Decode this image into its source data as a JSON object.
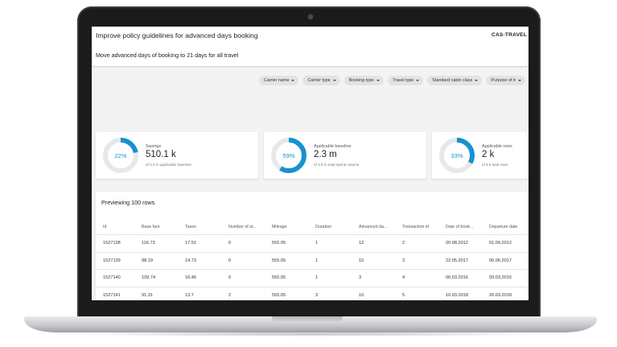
{
  "header": {
    "title": "Improve policy guidelines for advanced days booking",
    "brand": "CAS-TRAVEL",
    "subtitle": "Move advanced days of booking to 21 days for all travel"
  },
  "filters": [
    {
      "label": "Carrier name",
      "icon": "caret-down-icon"
    },
    {
      "label": "Carrier type",
      "icon": "caret-down-icon"
    },
    {
      "label": "Booking type",
      "icon": "caret-down-icon"
    },
    {
      "label": "Travel type",
      "icon": "caret-down-icon"
    },
    {
      "label": "Standard cabin class",
      "icon": "caret-down-icon"
    },
    {
      "label": "Purpose of tr",
      "icon": "caret-down-icon"
    }
  ],
  "kpis": [
    {
      "percent_label": "22%",
      "percent": 22,
      "label": "Savings",
      "value": "510.1 k",
      "sub": "of 2.3 m applicable baseline"
    },
    {
      "percent_label": "59%",
      "percent": 59,
      "label": "Applicable baseline",
      "value": "2.3 m",
      "sub": "of 3.9 m total spend volume"
    },
    {
      "percent_label": "33%",
      "percent": 33,
      "label": "Applicable rows",
      "value": "2 k",
      "sub": "of 6 k total rows"
    }
  ],
  "colors": {
    "accent": "#1592d0",
    "track": "#e8e8e8"
  },
  "table": {
    "title": "Previewing 100 rows",
    "columns": [
      "Id",
      "Base fare",
      "Taxes",
      "Number of st...",
      "Mileage",
      "Duration",
      "Advanced da...",
      "Transaction id",
      "Date of book...",
      "Departure date"
    ],
    "rows": [
      [
        "1527138",
        "116.73",
        "17.51",
        "0",
        "555.05",
        "1",
        "12",
        "2",
        "20.08.2012",
        "01.09.2012"
      ],
      [
        "1527139",
        "98.19",
        "14.73",
        "0",
        "555.05",
        "1",
        "15",
        "3",
        "22.05.2017",
        "06.06.2017"
      ],
      [
        "1527140",
        "109.74",
        "16.46",
        "0",
        "555.05",
        "1",
        "3",
        "4",
        "06.03.2016",
        "09.03.2016"
      ],
      [
        "1527141",
        "91.31",
        "13.7",
        "2",
        "555.05",
        "3",
        "10",
        "5",
        "16.03.2018",
        "26.03.2018"
      ]
    ]
  }
}
